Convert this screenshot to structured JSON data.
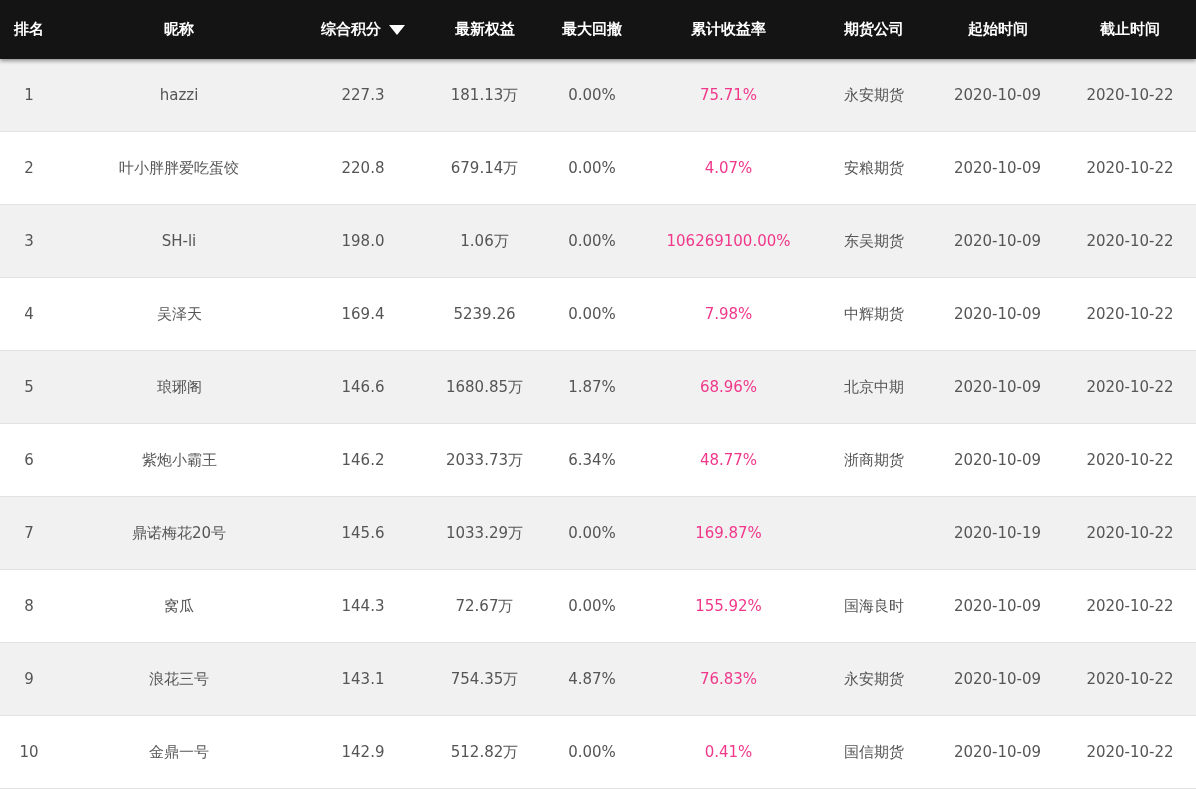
{
  "table": {
    "columns": [
      {
        "label": "排名",
        "kind": "plain",
        "sorted": false
      },
      {
        "label": "昵称",
        "kind": "plain",
        "sorted": false
      },
      {
        "label": "综合积分",
        "kind": "plain",
        "sorted": true
      },
      {
        "label": "最新权益",
        "kind": "plain",
        "sorted": false
      },
      {
        "label": "最大回撤",
        "kind": "plain",
        "sorted": false
      },
      {
        "label": "累计收益率",
        "kind": "rate",
        "sorted": false
      },
      {
        "label": "期货公司",
        "kind": "plain",
        "sorted": false
      },
      {
        "label": "起始时间",
        "kind": "plain",
        "sorted": false
      },
      {
        "label": "截止时间",
        "kind": "plain",
        "sorted": false
      }
    ],
    "rows": [
      [
        "1",
        "hazzi",
        "227.3",
        "181.13万",
        "0.00%",
        "75.71%",
        "永安期货",
        "2020-10-09",
        "2020-10-22"
      ],
      [
        "2",
        "叶小胖胖爱吃蛋饺",
        "220.8",
        "679.14万",
        "0.00%",
        "4.07%",
        "安粮期货",
        "2020-10-09",
        "2020-10-22"
      ],
      [
        "3",
        "SH-li",
        "198.0",
        "1.06万",
        "0.00%",
        "106269100.00%",
        "东吴期货",
        "2020-10-09",
        "2020-10-22"
      ],
      [
        "4",
        "吴泽天",
        "169.4",
        "5239.26",
        "0.00%",
        "7.98%",
        "中辉期货",
        "2020-10-09",
        "2020-10-22"
      ],
      [
        "5",
        "琅琊阁",
        "146.6",
        "1680.85万",
        "1.87%",
        "68.96%",
        "北京中期",
        "2020-10-09",
        "2020-10-22"
      ],
      [
        "6",
        "紫炮小霸王",
        "146.2",
        "2033.73万",
        "6.34%",
        "48.77%",
        "浙商期货",
        "2020-10-09",
        "2020-10-22"
      ],
      [
        "7",
        "鼎诺梅花20号",
        "145.6",
        "1033.29万",
        "0.00%",
        "169.87%",
        null,
        "2020-10-19",
        "2020-10-22"
      ],
      [
        "8",
        "窝瓜",
        "144.3",
        "72.67万",
        "0.00%",
        "155.92%",
        "国海良时",
        "2020-10-09",
        "2020-10-22"
      ],
      [
        "9",
        "浪花三号",
        "143.1",
        "754.35万",
        "4.87%",
        "76.83%",
        "永安期货",
        "2020-10-09",
        "2020-10-22"
      ],
      [
        "10",
        "金鼎一号",
        "142.9",
        "512.82万",
        "0.00%",
        "0.41%",
        "国信期货",
        "2020-10-09",
        "2020-10-22"
      ]
    ]
  }
}
